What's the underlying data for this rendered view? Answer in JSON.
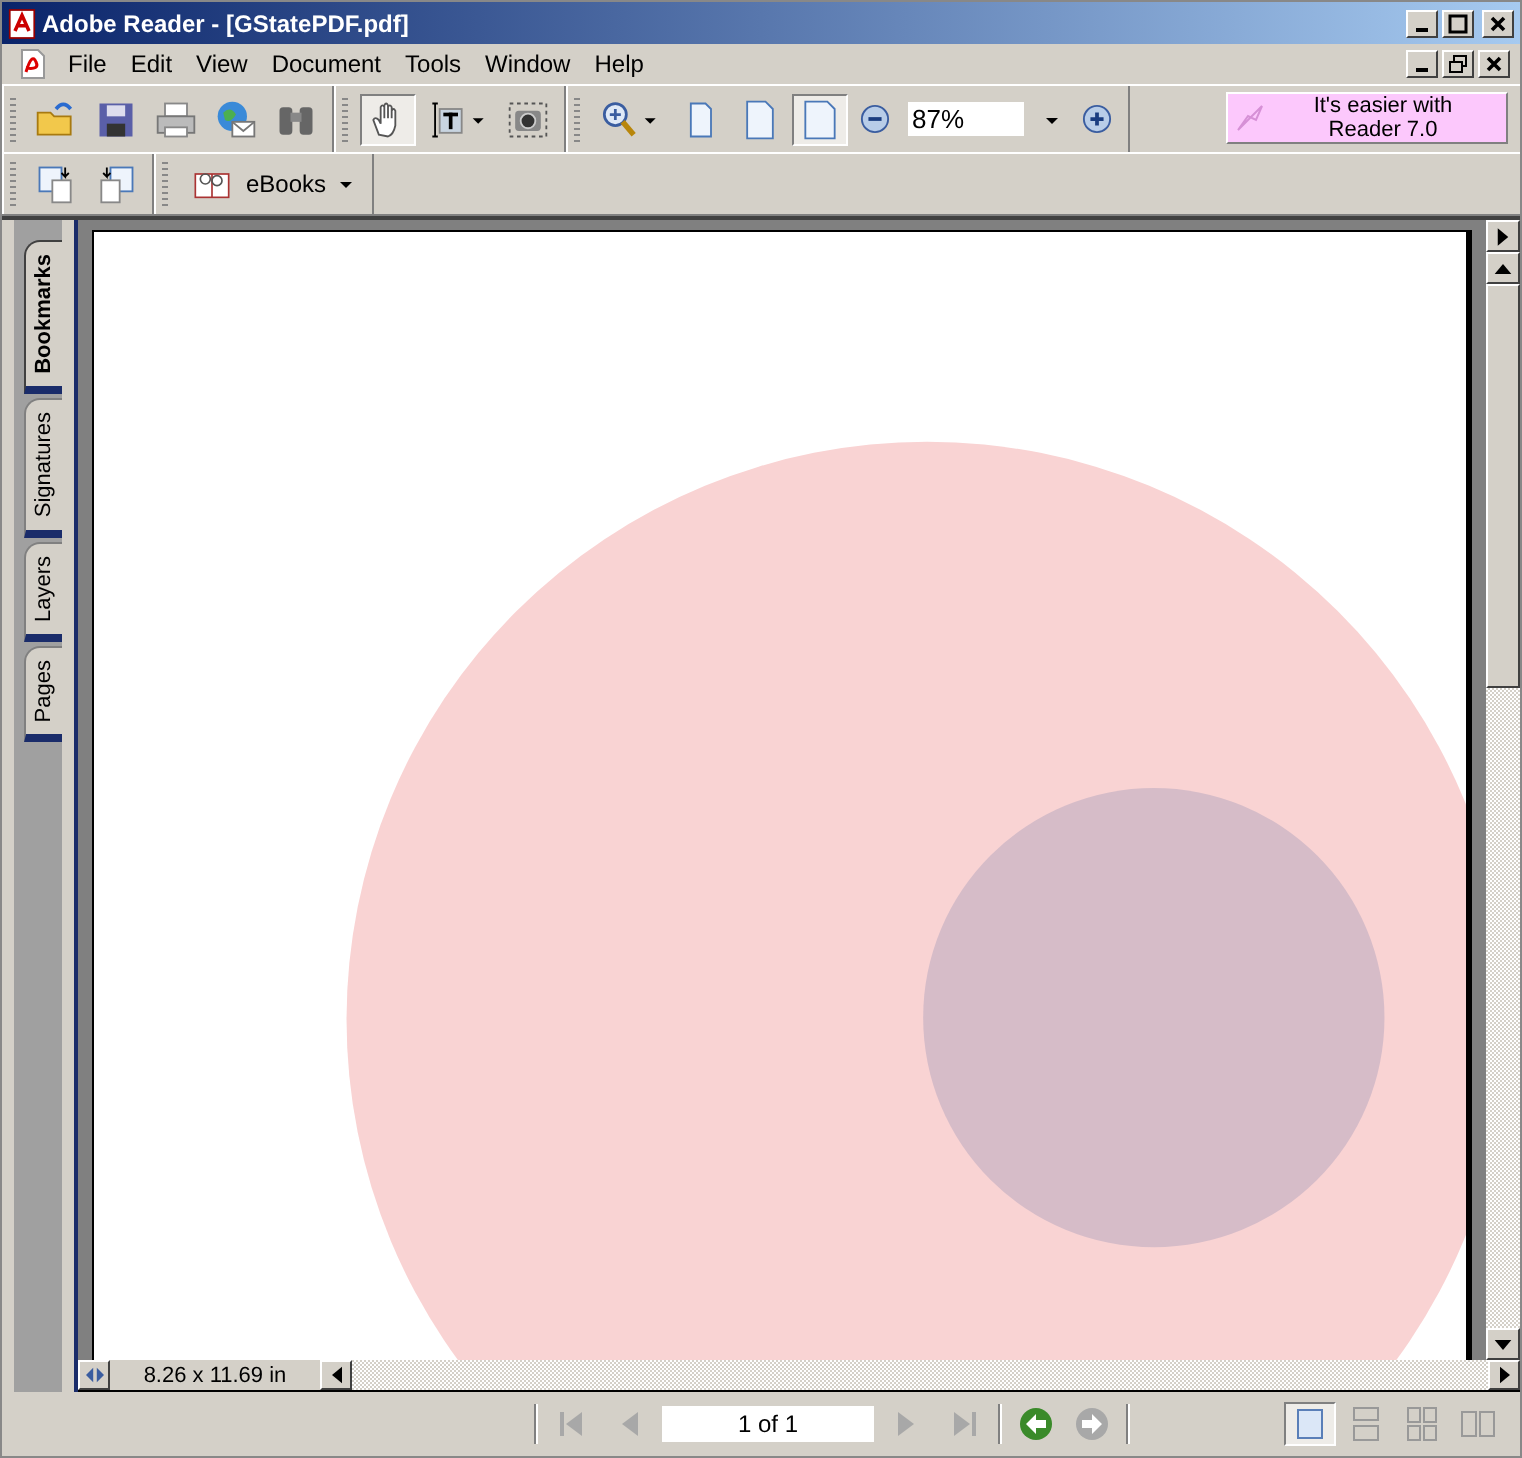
{
  "window": {
    "title": "Adobe Reader - [GStatePDF.pdf]"
  },
  "menu": [
    "File",
    "Edit",
    "View",
    "Document",
    "Tools",
    "Window",
    "Help"
  ],
  "select_tools": [
    {
      "kind": "hand",
      "selected": true
    },
    {
      "kind": "text_select",
      "selected": false
    },
    {
      "kind": "snapshot",
      "selected": false
    }
  ],
  "view_buttons": [
    {
      "kind": "actual_size",
      "selected": false
    },
    {
      "kind": "fit_page",
      "selected": false
    },
    {
      "kind": "fit_width",
      "selected": true
    }
  ],
  "zoom": {
    "value": "87%"
  },
  "promo": {
    "text": "It's easier with Reader 7.0"
  },
  "ebooks": {
    "label": "eBooks"
  },
  "side_tabs": [
    {
      "label": "Bookmarks",
      "selected": true
    },
    {
      "label": "Signatures",
      "selected": false
    },
    {
      "label": "Layers",
      "selected": false
    },
    {
      "label": "Pages",
      "selected": false
    }
  ],
  "page_size": "8.26 x 11.69 in",
  "navigation": {
    "page_field": "1 of 1",
    "buttons": [
      {
        "kind": "first",
        "disabled": true
      },
      {
        "kind": "prev",
        "disabled": true
      },
      {
        "kind": "next",
        "disabled": true
      },
      {
        "kind": "last",
        "disabled": true
      }
    ],
    "history": [
      {
        "kind": "back",
        "disabled": false
      },
      {
        "kind": "forward",
        "disabled": true
      }
    ]
  },
  "page_layouts": [
    {
      "kind": "single",
      "selected": true
    },
    {
      "kind": "continuous",
      "selected": false
    },
    {
      "kind": "facing_continuous",
      "selected": false
    },
    {
      "kind": "facing",
      "selected": false
    }
  ]
}
